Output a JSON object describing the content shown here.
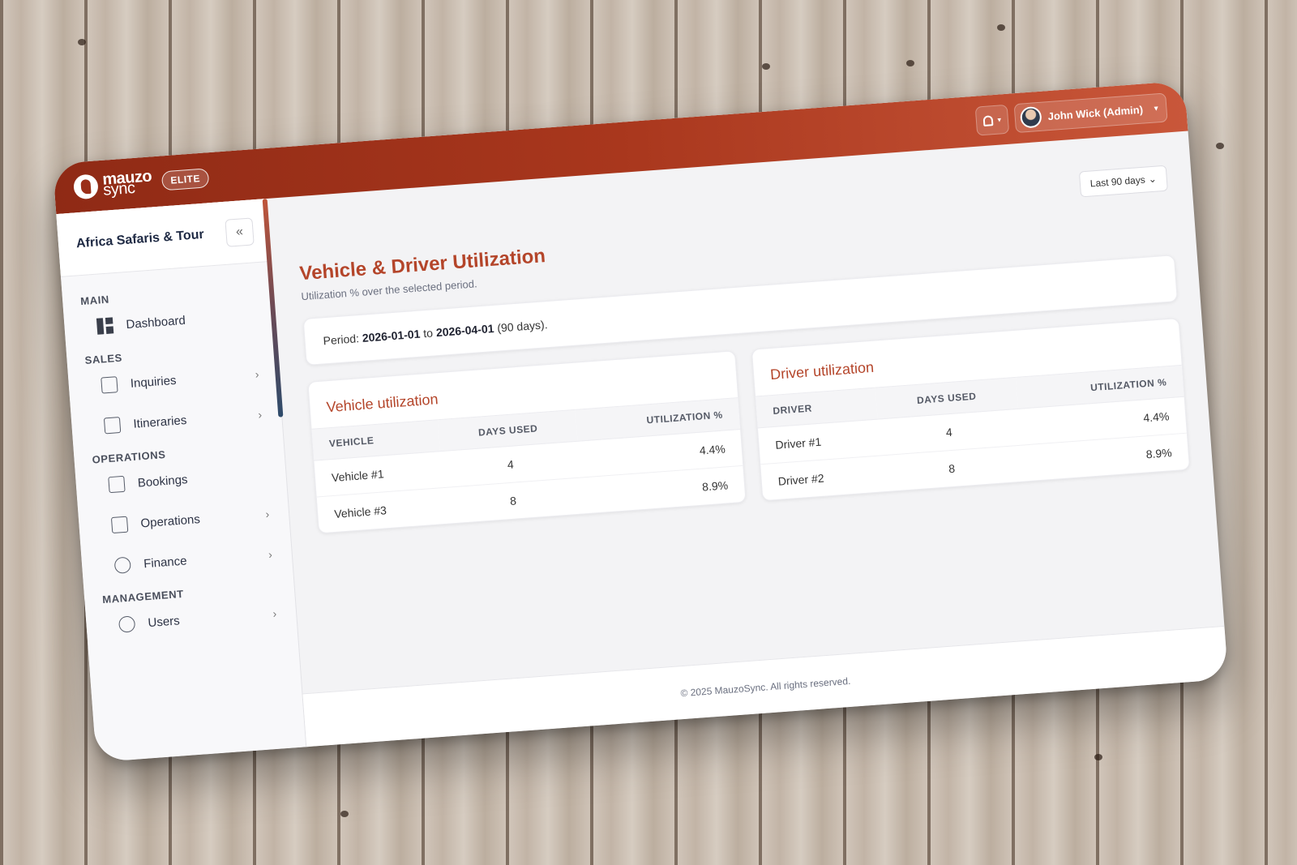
{
  "topbar": {
    "logo_line1": "mauzo",
    "logo_line2": "sync",
    "badge": "ELITE",
    "user_name": "John Wick (Admin)"
  },
  "sidebar": {
    "company": "Africa Safaris & Tour",
    "collapse_label": "«",
    "sections": {
      "main": "MAIN",
      "sales": "SALES",
      "operations": "OPERATIONS",
      "management": "MANAGEMENT"
    },
    "items": {
      "dashboard": "Dashboard",
      "inquiries": "Inquiries",
      "itineraries": "Itineraries",
      "bookings": "Bookings",
      "operations": "Operations",
      "finance": "Finance",
      "users": "Users"
    }
  },
  "main": {
    "range_select": "Last 90 days",
    "title": "Vehicle & Driver Utilization",
    "subtitle": "Utilization % over the selected period.",
    "period": {
      "label": "Period:",
      "start": "2026-01-01",
      "to": "to",
      "end": "2026-04-01",
      "days": "(90 days)."
    },
    "vehicle_table": {
      "title": "Vehicle utilization",
      "headers": [
        "VEHICLE",
        "DAYS USED",
        "UTILIZATION %"
      ],
      "rows": [
        [
          "Vehicle #1",
          "4",
          "4.4%"
        ],
        [
          "Vehicle #3",
          "8",
          "8.9%"
        ]
      ]
    },
    "driver_table": {
      "title": "Driver utilization",
      "headers": [
        "DRIVER",
        "DAYS USED",
        "UTILIZATION %"
      ],
      "rows": [
        [
          "Driver #1",
          "4",
          "4.4%"
        ],
        [
          "Driver #2",
          "8",
          "8.9%"
        ]
      ]
    }
  },
  "footer": "© 2025 MauzoSync. All rights reserved."
}
